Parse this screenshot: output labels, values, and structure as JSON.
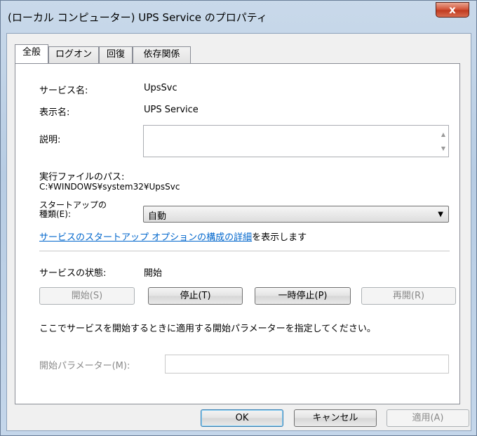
{
  "window": {
    "title": "(ローカル コンピューター) UPS Service のプロパティ",
    "close_label": "x"
  },
  "tabs": [
    {
      "label": "全般",
      "active": true
    },
    {
      "label": "ログオン"
    },
    {
      "label": "回復"
    },
    {
      "label": "依存関係"
    }
  ],
  "general": {
    "service_name_label": "サービス名:",
    "service_name_value": "UpsSvc",
    "display_name_label": "表示名:",
    "display_name_value": "UPS Service",
    "description_label": "説明:",
    "description_value": "",
    "exe_path_label": "実行ファイルのパス:",
    "exe_path_value": "C:¥WINDOWS¥system32¥UpsSvc",
    "startup_type_label_line1": "スタートアップの",
    "startup_type_label_line2": "種類(E):",
    "startup_type_value": "自動",
    "link_text": "サービスのスタートアップ オプションの構成の詳細",
    "link_suffix": "を表示します",
    "status_label": "サービスの状態:",
    "status_value": "開始",
    "buttons": {
      "start": "開始(S)",
      "stop": "停止(T)",
      "pause": "一時停止(P)",
      "resume": "再開(R)"
    },
    "param_hint": "ここでサービスを開始するときに適用する開始パラメーターを指定してください。",
    "param_label": "開始パラメーター(M):",
    "param_value": ""
  },
  "footer": {
    "ok": "OK",
    "cancel": "キャンセル",
    "apply": "適用(A)"
  }
}
